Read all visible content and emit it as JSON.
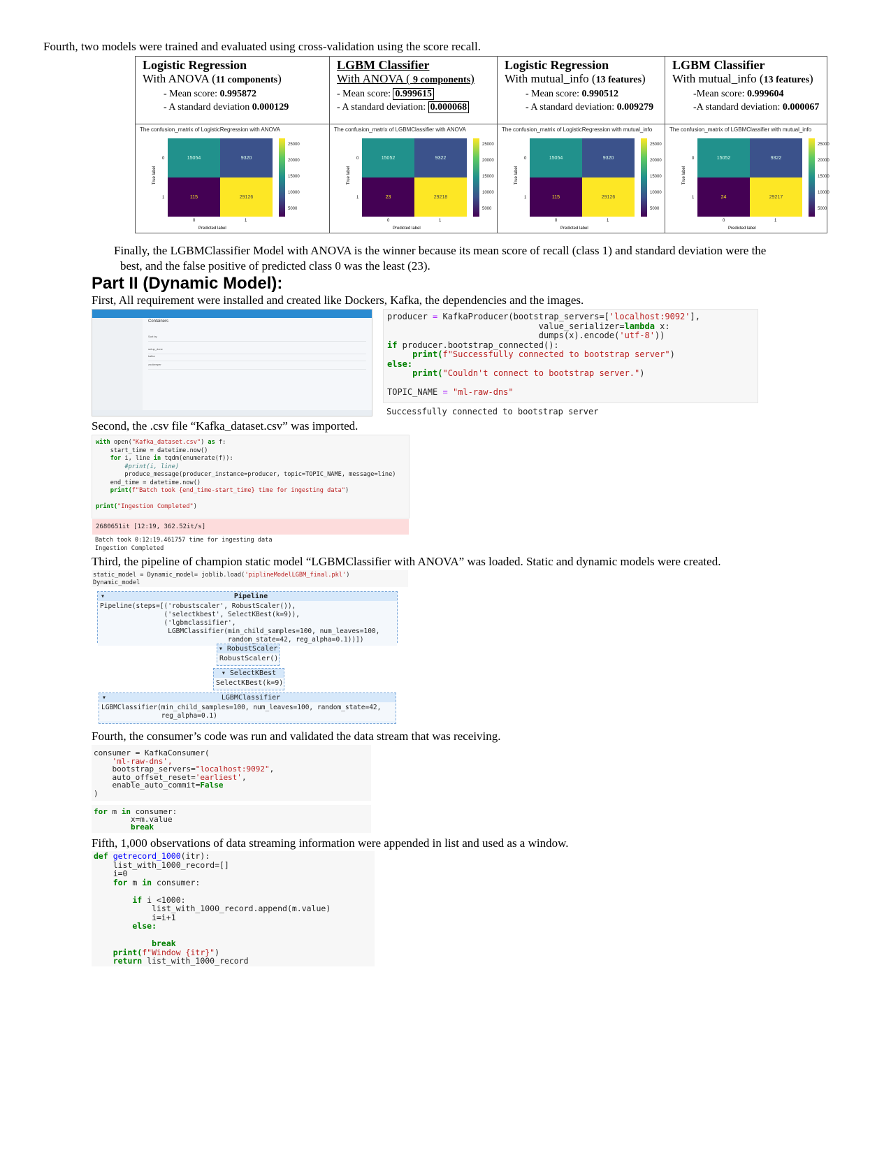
{
  "intro_text": "Fourth, two models were trained and evaluated using cross-validation using the score recall.",
  "models": [
    {
      "title": "Logistic Regression",
      "subtitle_pre": "With ANOVA (",
      "subtitle_bold": "11 components",
      "subtitle_post": ")",
      "mean_label": "- Mean score: ",
      "mean_value": "0.995872",
      "std_label": "- A standard deviation ",
      "std_value": "0.000129",
      "boxed": false,
      "cm": {
        "title": "The confusion_matrix of LogisticRegression with ANOVA",
        "tn": "15054",
        "fp": "9320",
        "fn": "115",
        "tp": "29126",
        "xlabel": "Predicted label",
        "ylabel": "True label",
        "ticks": [
          "25000",
          "20000",
          "15000",
          "10000",
          "5000"
        ],
        "ax0": "0",
        "ax1": "1"
      }
    },
    {
      "title": "LGBM Classifier",
      "subtitle_pre": "With ANOVA ( ",
      "subtitle_bold": "9 components",
      "subtitle_post": ")",
      "mean_label": "- Mean score: ",
      "mean_value": "0.999615",
      "std_label": "- A standard deviation: ",
      "std_value": "0.000068",
      "boxed": true,
      "cm": {
        "title": "The confusion_matrix of LGBMClassifier with ANOVA",
        "tn": "15052",
        "fp": "9322",
        "fn": "23",
        "tp": "29218",
        "xlabel": "Predicted label",
        "ylabel": "True label",
        "ticks": [
          "25000",
          "20000",
          "15000",
          "10000",
          "5000"
        ],
        "ax0": "0",
        "ax1": "1"
      }
    },
    {
      "title": "Logistic Regression",
      "subtitle_pre": "With mutual_info (",
      "subtitle_bold": "13 features",
      "subtitle_post": ")",
      "mean_label": "- Mean score: ",
      "mean_value": "0.990512",
      "std_label": "- A standard deviation: ",
      "std_value": "0.009279",
      "boxed": false,
      "cm": {
        "title": "The confusion_matrix of LogisticRegression with mutual_info",
        "tn": "15054",
        "fp": "9320",
        "fn": "115",
        "tp": "29126",
        "xlabel": "Predicted label",
        "ylabel": "True label",
        "ticks": [
          "25000",
          "20000",
          "15000",
          "10000",
          "5000"
        ],
        "ax0": "0",
        "ax1": "1"
      }
    },
    {
      "title": "LGBM Classifier",
      "subtitle_pre": "With mutual_info (",
      "subtitle_bold": "13 features",
      "subtitle_post": ")",
      "mean_label": "-Mean score: ",
      "mean_value": "0.999604",
      "std_label": "-A standard deviation: ",
      "std_value": "0.000067",
      "boxed": false,
      "cm": {
        "title": "The confusion_matrix of LGBMClassifier with mutual_info",
        "tn": "15052",
        "fp": "9322",
        "fn": "24",
        "tp": "29217",
        "xlabel": "Predicted label",
        "ylabel": "True label",
        "ticks": [
          "25000",
          "20000",
          "15000",
          "10000",
          "5000"
        ],
        "ax0": "0",
        "ax1": "1"
      }
    }
  ],
  "conclusion_line1": "Finally, the LGBMClassifier Model with ANOVA is the winner because its mean score of recall (class 1) and standard deviation were the",
  "conclusion_line2": "best, and the false positive of predicted class 0 was the least (23).",
  "part2_heading": "Part II (Dynamic Model):",
  "step1_text": "First, All requirement were installed and created like Dockers, Kafka, the dependencies and the images.",
  "docker": {
    "title": "Containers",
    "rows": [
      "Sort by",
      "setup_done",
      "kafka",
      "zookeeper"
    ]
  },
  "producer_code": {
    "l1a": "producer",
    "l1b": " = ",
    "l1c": "KafkaProducer(bootstrap_servers=[",
    "l1d": "'localhost:9092'",
    "l1e": "],",
    "l2a": "value_serializer=",
    "l2b": "lambda",
    "l2c": " x:",
    "l3a": "dumps(x).encode(",
    "l3b": "'utf-8'",
    "l3c": "))",
    "l4a": "if",
    "l4b": " producer.bootstrap_connected():",
    "l5a": "print(",
    "l5b": "f\"Successfully connected to bootstrap server\"",
    "l5c": ")",
    "l6a": "else:",
    "l7a": "print(",
    "l7b": "\"Couldn't connect to bootstrap server.\"",
    "l7c": ")",
    "l8a": "TOPIC_NAME",
    "l8b": " = ",
    "l8c": "\"ml-raw-dns\"",
    "output": "Successfully connected to bootstrap server"
  },
  "step2_text": "Second, the .csv file “Kafka_dataset.csv” was imported.",
  "ingest_code": {
    "l1a": "with",
    "l1b": " open(",
    "l1c": "\"Kafka_dataset.csv\"",
    "l1d": ") ",
    "l1e": "as",
    "l1f": " f:",
    "l2": "    start_time = datetime.now()",
    "l3a": "    for",
    "l3b": " i, line ",
    "l3c": "in",
    "l3d": " tqdm(enumerate(f)):",
    "l4": "        #print(i, line)",
    "l5": "        produce_message(producer_instance=producer, topic=TOPIC_NAME, message=line)",
    "l6": "    end_time = datetime.now()",
    "l7a": "    print(",
    "l7b": "f\"Batch took {end_time-start_time} time for ingesting data\"",
    "l7c": ")",
    "l8a": "print(",
    "l8b": "\"Ingestion Completed\"",
    "l8c": ")",
    "progress": "2680651it [12:19, 362.52it/s]",
    "out1": "Batch took 0:12:19.461757 time for ingesting data",
    "out2": "Ingestion Completed"
  },
  "step3_text": "Third, the pipeline of champion static model “LGBMClassifier with ANOVA” was loaded. Static and dynamic models were created.",
  "load_code": {
    "l1a": "static_model = Dynamic_model= joblib.load(",
    "l1b": "'piplineModelLGBM_final.pkl'",
    "l1c": ")",
    "l2": "Dynamic_model"
  },
  "pipeline": {
    "head": "Pipeline",
    "body": "Pipeline(steps=[('robustscaler', RobustScaler()),\n                ('selectkbest', SelectKBest(k=9)),\n                ('lgbmclassifier',\n                 LGBMClassifier(min_child_samples=100, num_leaves=100,\n                                random_state=42, reg_alpha=0.1))])",
    "scaler_head": "RobustScaler",
    "scaler_body": "RobustScaler()",
    "select_head": "SelectKBest",
    "select_body": "SelectKBest(k=9)",
    "lgbm_head": "LGBMClassifier",
    "lgbm_body": "LGBMClassifier(min_child_samples=100, num_leaves=100, random_state=42,\n               reg_alpha=0.1)"
  },
  "step4_text": "Fourth, the consumer’s code was run and validated the data stream that was receiving.",
  "consumer_code": {
    "l1": "consumer = KafkaConsumer(",
    "l2": "    'ml-raw-dns',",
    "l3a": "    bootstrap_servers=",
    "l3b": "\"localhost:9092\"",
    "l3c": ",",
    "l4a": "    auto_offset_reset=",
    "l4b": "'earliest'",
    "l4c": ",",
    "l5a": "    enable_auto_commit=",
    "l5b": "False",
    "l6": ")",
    "loop1a": "for",
    "loop1b": " m ",
    "loop1c": "in",
    "loop1d": " consumer:",
    "loop2": "        x=m.value",
    "loop3": "        break"
  },
  "step5_text": "Fifth, 1,000 observations of data streaming information were appended in list and used as a window.",
  "window_code": {
    "l1a": "def",
    "l1b": " getrecord_1000",
    "l1c": "(itr):",
    "l2": "    list_with_1000_record=[]",
    "l3": "    i=0",
    "l4a": "    for",
    "l4b": " m ",
    "l4c": "in",
    "l4d": " consumer:",
    "l5a": "        if",
    "l5b": " i <1000:",
    "l6": "            list_with_1000_record.append(m.value)",
    "l7": "            i=i+1",
    "l8": "        else:",
    "l9": "            break",
    "l10a": "    print(",
    "l10b": "f\"Window {itr}\"",
    "l10c": ")",
    "l11a": "    return",
    "l11b": " list_with_1000_record"
  }
}
